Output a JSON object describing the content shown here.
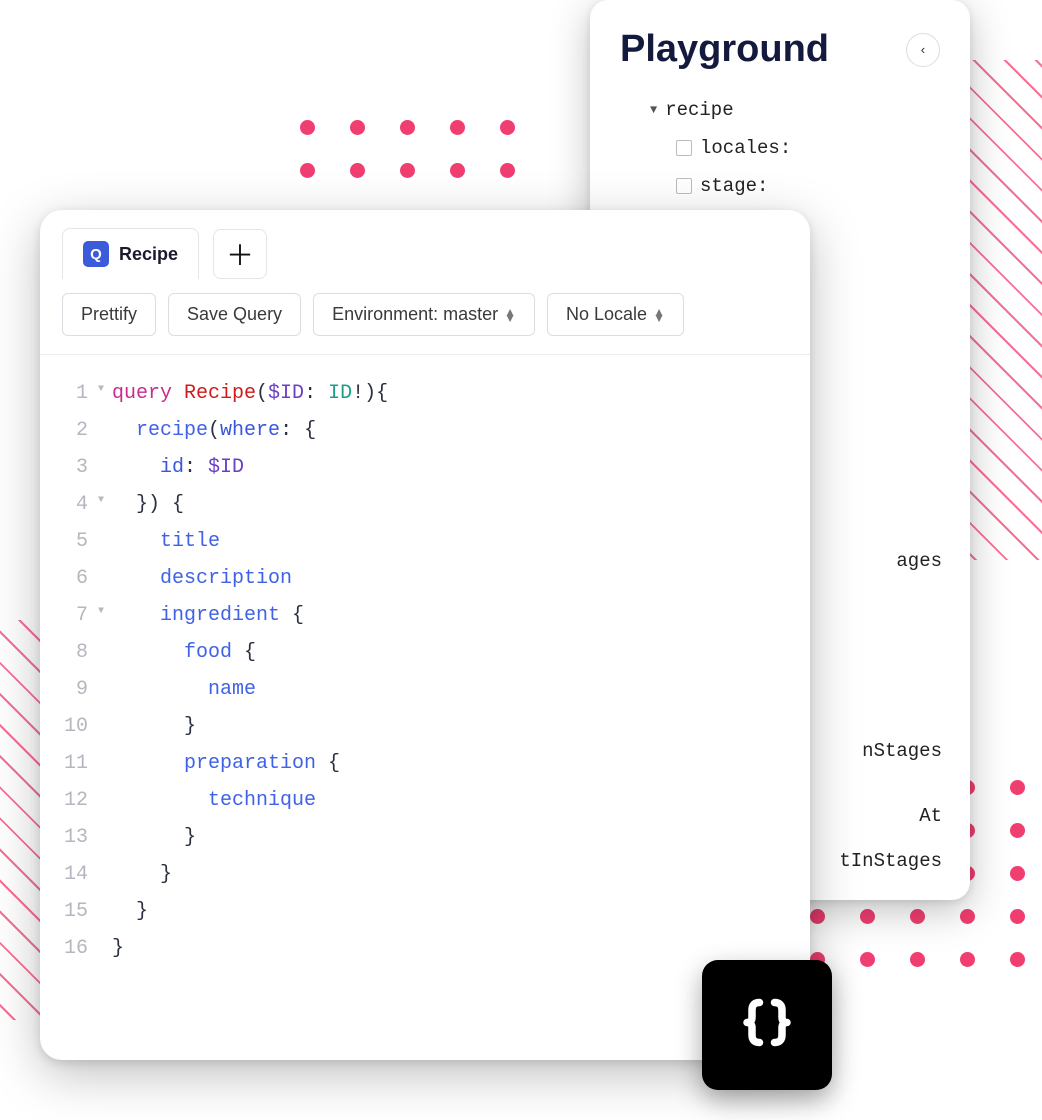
{
  "playground": {
    "title": "Playground",
    "tree": {
      "root": "recipe",
      "args": [
        "locales:",
        "stage:"
      ]
    },
    "peek_items": [
      "ages",
      "nStages",
      "At",
      "tInStages"
    ]
  },
  "editor": {
    "tab_badge": "Q",
    "tab_label": "Recipe",
    "toolbar": {
      "prettify": "Prettify",
      "save": "Save Query",
      "environment": "Environment: master",
      "locale": "No Locale"
    },
    "code": [
      {
        "n": 1,
        "fold": true,
        "tokens": [
          [
            "kw",
            "query "
          ],
          [
            "name",
            "Recipe"
          ],
          [
            "punc",
            "("
          ],
          [
            "var",
            "$ID"
          ],
          [
            "punc",
            ": "
          ],
          [
            "type",
            "ID"
          ],
          [
            "punc",
            "!){"
          ]
        ]
      },
      {
        "n": 2,
        "fold": false,
        "tokens": [
          [
            "punc",
            "  "
          ],
          [
            "field",
            "recipe"
          ],
          [
            "punc",
            "("
          ],
          [
            "arg",
            "where"
          ],
          [
            "punc",
            ": {"
          ]
        ]
      },
      {
        "n": 3,
        "fold": false,
        "tokens": [
          [
            "punc",
            "    "
          ],
          [
            "arg",
            "id"
          ],
          [
            "punc",
            ": "
          ],
          [
            "var",
            "$ID"
          ]
        ]
      },
      {
        "n": 4,
        "fold": true,
        "tokens": [
          [
            "punc",
            "  }) {"
          ]
        ]
      },
      {
        "n": 5,
        "fold": false,
        "tokens": [
          [
            "punc",
            "    "
          ],
          [
            "field",
            "title"
          ]
        ]
      },
      {
        "n": 6,
        "fold": false,
        "tokens": [
          [
            "punc",
            "    "
          ],
          [
            "field",
            "description"
          ]
        ]
      },
      {
        "n": 7,
        "fold": true,
        "tokens": [
          [
            "punc",
            "    "
          ],
          [
            "field",
            "ingredient"
          ],
          [
            "punc",
            " {"
          ]
        ]
      },
      {
        "n": 8,
        "fold": false,
        "tokens": [
          [
            "punc",
            "      "
          ],
          [
            "field",
            "food"
          ],
          [
            "punc",
            " {"
          ]
        ]
      },
      {
        "n": 9,
        "fold": false,
        "tokens": [
          [
            "punc",
            "        "
          ],
          [
            "field",
            "name"
          ]
        ]
      },
      {
        "n": 10,
        "fold": false,
        "tokens": [
          [
            "punc",
            "      }"
          ]
        ]
      },
      {
        "n": 11,
        "fold": false,
        "tokens": [
          [
            "punc",
            "      "
          ],
          [
            "field",
            "preparation"
          ],
          [
            "punc",
            " {"
          ]
        ]
      },
      {
        "n": 12,
        "fold": false,
        "tokens": [
          [
            "punc",
            "        "
          ],
          [
            "field",
            "technique"
          ]
        ]
      },
      {
        "n": 13,
        "fold": false,
        "tokens": [
          [
            "punc",
            "      }"
          ]
        ]
      },
      {
        "n": 14,
        "fold": false,
        "tokens": [
          [
            "punc",
            "    }"
          ]
        ]
      },
      {
        "n": 15,
        "fold": false,
        "tokens": [
          [
            "punc",
            "  }"
          ]
        ]
      },
      {
        "n": 16,
        "fold": false,
        "tokens": [
          [
            "punc",
            "}"
          ]
        ]
      }
    ]
  }
}
